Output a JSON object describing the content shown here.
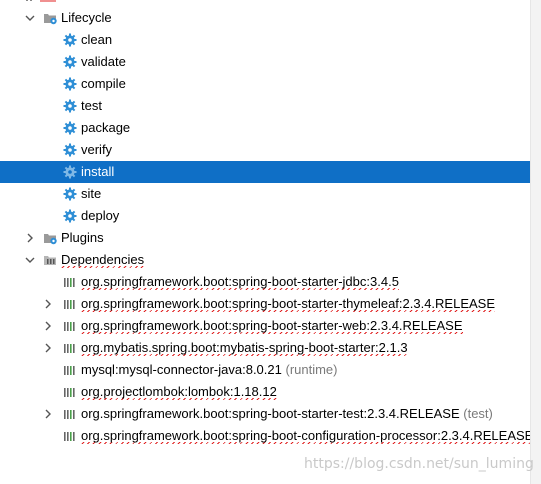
{
  "tree": {
    "lifecycle": {
      "label": "Lifecycle",
      "phases": [
        {
          "label": "clean"
        },
        {
          "label": "validate"
        },
        {
          "label": "compile"
        },
        {
          "label": "test"
        },
        {
          "label": "package"
        },
        {
          "label": "verify"
        },
        {
          "label": "install",
          "selected": true
        },
        {
          "label": "site"
        },
        {
          "label": "deploy"
        }
      ]
    },
    "plugins": {
      "label": "Plugins"
    },
    "dependencies": {
      "label": "Dependencies",
      "items": [
        {
          "label": "org.springframework.boot:spring-boot-starter-jdbc:3.4.5",
          "scope": "",
          "expandable": false
        },
        {
          "label": "org.springframework.boot:spring-boot-starter-thymeleaf:2.3.4.RELEASE",
          "scope": "",
          "expandable": true
        },
        {
          "label": "org.springframework.boot:spring-boot-starter-web:2.3.4.RELEASE",
          "scope": "",
          "expandable": true
        },
        {
          "label": "org.mybatis.spring.boot:mybatis-spring-boot-starter:2.1.3",
          "scope": "",
          "expandable": true
        },
        {
          "label": "mysql:mysql-connector-java:8.0.21",
          "scope": "(runtime)",
          "expandable": false
        },
        {
          "label": "org.projectlombok:lombok:1.18.12",
          "scope": "",
          "expandable": false
        },
        {
          "label": "org.springframework.boot:spring-boot-starter-test:2.3.4.RELEASE",
          "scope": "(test)",
          "expandable": true
        },
        {
          "label": "org.springframework.boot:spring-boot-configuration-processor:2.3.4.RELEASE",
          "scope": "",
          "expandable": false
        }
      ]
    }
  },
  "watermark": "https://blog.csdn.net/sun_luming",
  "colors": {
    "selection": "#0f6fc6",
    "gear": "#2f8fd6",
    "folder": "#8a8a8a",
    "squiggle": "#e02020"
  },
  "icons": {
    "lifecycle": "maven-lifecycle-folder-icon",
    "phase": "gear-icon",
    "plugins": "folder-icon",
    "dependencies": "library-folder-icon",
    "dependency": "library-icon"
  }
}
